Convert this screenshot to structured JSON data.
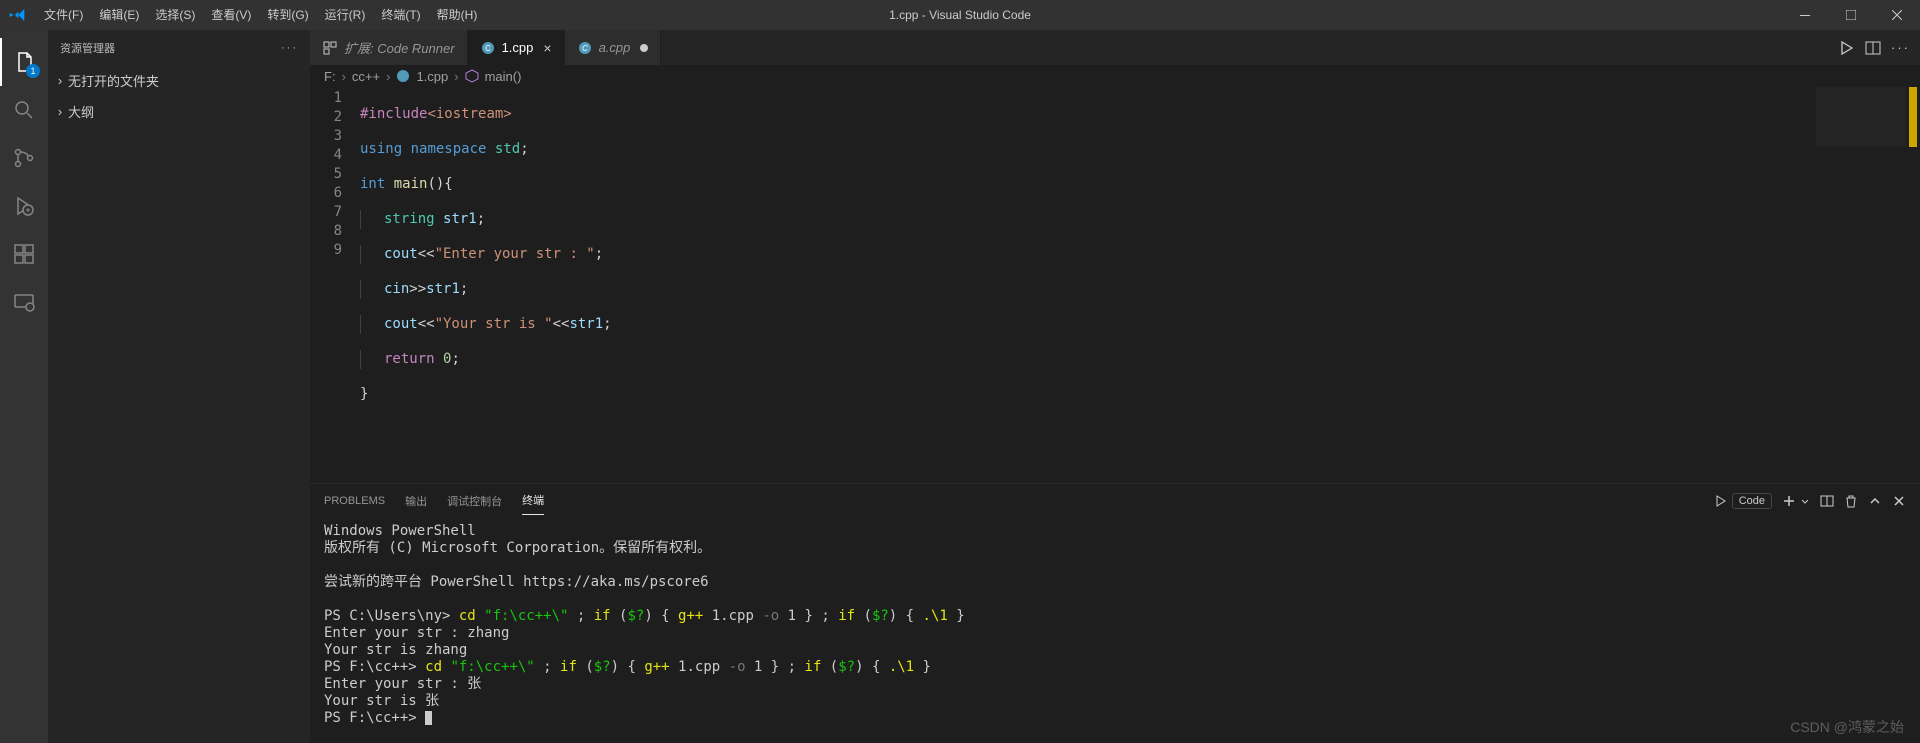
{
  "titlebar": {
    "title": "1.cpp - Visual Studio Code",
    "menu": [
      "文件(F)",
      "编辑(E)",
      "选择(S)",
      "查看(V)",
      "转到(G)",
      "运行(R)",
      "终端(T)",
      "帮助(H)"
    ]
  },
  "activitybar": {
    "badge": "1"
  },
  "sidebar": {
    "title": "资源管理器",
    "sections": [
      {
        "label": "无打开的文件夹"
      },
      {
        "label": "大纲"
      }
    ]
  },
  "tabs": {
    "items": [
      {
        "label": "扩展: Code Runner"
      },
      {
        "label": "1.cpp"
      },
      {
        "label": "a.cpp"
      }
    ]
  },
  "breadcrumb": {
    "parts": [
      "F:",
      "cc++",
      "1.cpp",
      "main()"
    ]
  },
  "code": {
    "lines": [
      "1",
      "2",
      "3",
      "4",
      "5",
      "6",
      "7",
      "8",
      "9"
    ]
  },
  "panel": {
    "tabs": [
      "PROBLEMS",
      "输出",
      "调试控制台",
      "终端"
    ],
    "launch": "Code"
  },
  "terminal": {
    "l1": "Windows PowerShell",
    "l2": "版权所有 (C) Microsoft Corporation。保留所有权利。",
    "l3": "尝试新的跨平台 PowerShell https://aka.ms/pscore6",
    "p1a": "PS C:\\Users\\ny> ",
    "p1b": "cd",
    "p1c": " \"f:\\cc++\\\"",
    "p1d": " ; ",
    "p1e": "if",
    "p1f": " (",
    "p1g": "$?",
    "p1h": ") { ",
    "p1i": "g++",
    "p1j": " 1.cpp ",
    "p1k": "-o",
    "p1l": " 1 } ; ",
    "p1m": "if",
    "p1n": " (",
    "p1o": "$?",
    "p1p": ") { ",
    "p1q": ".\\1",
    "p1r": " }",
    "l5": "Enter your str : zhang",
    "l6": "Your str is zhang",
    "p2a": "PS F:\\cc++> ",
    "l8": "Enter your str : 张",
    "l9": "Your str is 张",
    "p3": "PS F:\\cc++> "
  },
  "watermark": "CSDN @鸿蒙之始"
}
